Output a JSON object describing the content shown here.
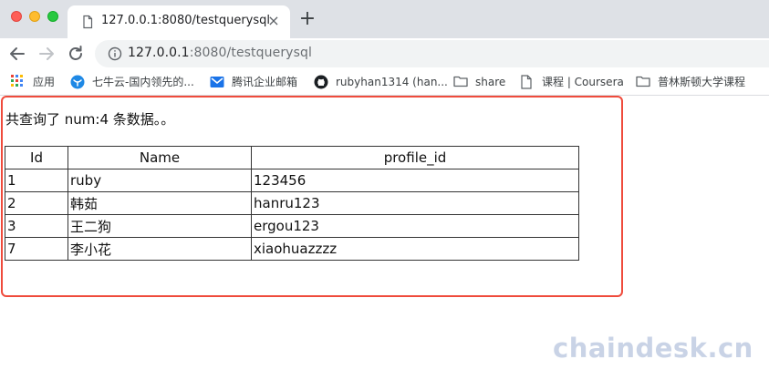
{
  "browser": {
    "tab": {
      "title": "127.0.0.1:8080/testquerysql",
      "close_glyph": "×"
    },
    "new_tab_glyph": "+",
    "address_bar": {
      "host": "127.0.0.1",
      "rest": ":8080/testquerysql"
    },
    "bookmarks": [
      {
        "label": "应用",
        "icon": "apps-grid-icon"
      },
      {
        "label": "七牛云-国内领先的...",
        "icon": "qiniu-logo-icon"
      },
      {
        "label": "腾讯企业邮箱",
        "icon": "tencent-mail-icon"
      },
      {
        "label": "rubyhan1314 (han...",
        "icon": "github-icon"
      },
      {
        "label": "share",
        "icon": "folder-icon"
      },
      {
        "label": "课程 | Coursera",
        "icon": "page-icon"
      },
      {
        "label": "普林斯顿大学课程",
        "icon": "folder-icon"
      }
    ]
  },
  "page": {
    "summary": "共查询了 num:4 条数据。。",
    "table": {
      "headers": [
        "Id",
        "Name",
        "profile_id"
      ],
      "rows": [
        [
          "1",
          "ruby",
          "123456"
        ],
        [
          "2",
          "韩茹",
          "hanru123"
        ],
        [
          "3",
          "王二狗",
          "ergou123"
        ],
        [
          "7",
          "李小花",
          "xiaohuazzzz"
        ]
      ]
    }
  },
  "watermark": "chaindesk.cn",
  "colors": {
    "highlight_border": "#ef4b3c",
    "tabstrip": "#dee1e6",
    "watermark": "#c9d3e6"
  }
}
